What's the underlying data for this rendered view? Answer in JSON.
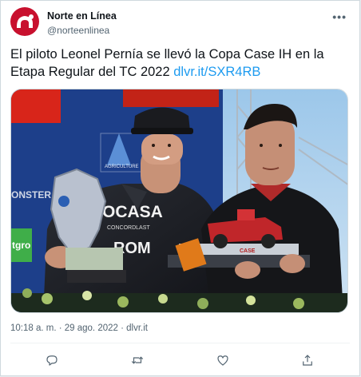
{
  "tweet": {
    "author_name": "Norte en Línea",
    "author_handle": "@norteenlinea",
    "text_main": "El piloto Leonel Pernía se llevó la Copa Case IH en la Etapa Regular del TC 2022 ",
    "text_link": "dlvr.it/SXR4RB",
    "timestamp": "10:18 a. m. · 29 ago. 2022 · dlvr.it"
  },
  "photo": {
    "banner_word": "AGRICULTURE",
    "suit_brand_1": "OCASA",
    "suit_brand_2": "CONCORDLAST",
    "suit_brand_3": "ROM",
    "trophy_plate": "CASE",
    "side_banner": "ONSTER",
    "green_brand": "tgro"
  },
  "actions": {
    "icons": [
      "reply-icon",
      "retweet-icon",
      "like-icon",
      "share-icon"
    ]
  },
  "colors": {
    "link": "#1d9bf0",
    "text": "#0f1419",
    "secondary": "#536471",
    "avatar_bg": "#c8102e"
  }
}
